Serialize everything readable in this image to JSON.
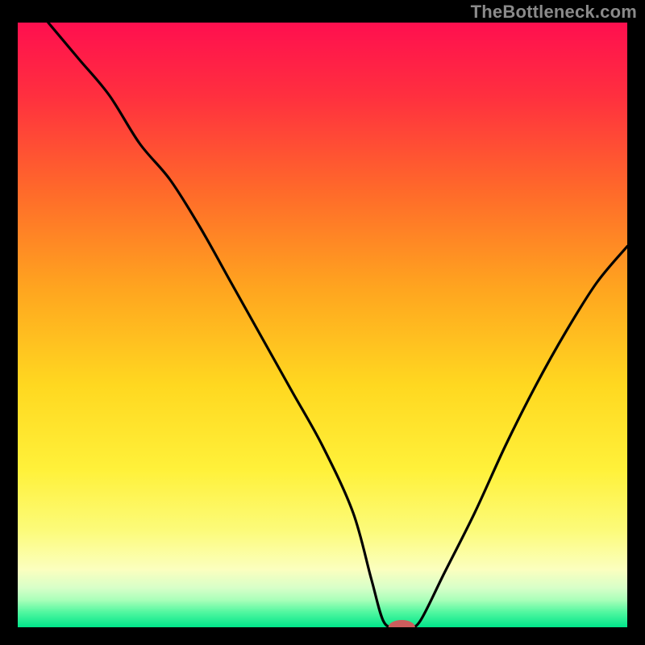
{
  "watermark": "TheBottleneck.com",
  "colors": {
    "stroke": "#000000",
    "marker_fill": "#cc5d5d",
    "gradient_stops": [
      {
        "offset": 0.0,
        "color": "#ff0f4f"
      },
      {
        "offset": 0.12,
        "color": "#ff2f3f"
      },
      {
        "offset": 0.28,
        "color": "#ff6a2a"
      },
      {
        "offset": 0.44,
        "color": "#ffa51f"
      },
      {
        "offset": 0.6,
        "color": "#ffd820"
      },
      {
        "offset": 0.74,
        "color": "#fff13a"
      },
      {
        "offset": 0.84,
        "color": "#fcfb7a"
      },
      {
        "offset": 0.905,
        "color": "#fbffbf"
      },
      {
        "offset": 0.935,
        "color": "#d7ffc8"
      },
      {
        "offset": 0.955,
        "color": "#a9ffb9"
      },
      {
        "offset": 0.975,
        "color": "#52f7a0"
      },
      {
        "offset": 1.0,
        "color": "#00e58a"
      }
    ]
  },
  "chart_data": {
    "type": "line",
    "title": "",
    "xlabel": "",
    "ylabel": "",
    "xlim": [
      0,
      100
    ],
    "ylim": [
      0,
      100
    ],
    "x": [
      5,
      10,
      15,
      20,
      25,
      30,
      35,
      40,
      45,
      50,
      55,
      58,
      60,
      62,
      64,
      66,
      70,
      75,
      80,
      85,
      90,
      95,
      100
    ],
    "values": [
      100,
      94,
      88,
      80,
      74,
      66,
      57,
      48,
      39,
      30,
      19,
      8,
      1,
      0,
      0,
      1,
      9,
      19,
      30,
      40,
      49,
      57,
      63
    ],
    "marker": {
      "x": 63,
      "y": 0,
      "rx": 2.2,
      "ry": 1.2
    }
  }
}
